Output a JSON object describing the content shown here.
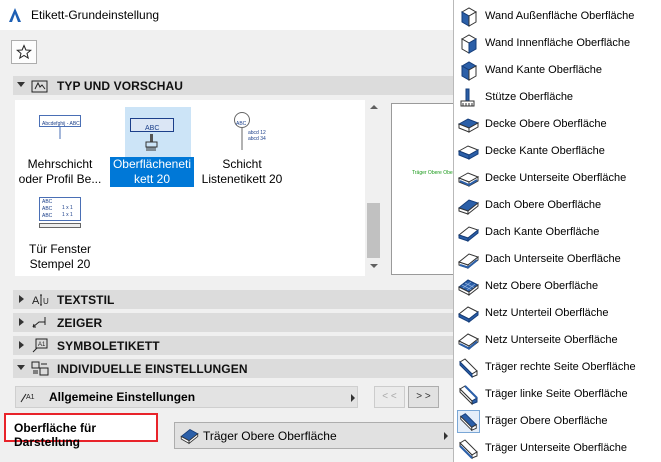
{
  "window": {
    "title": "Etikett-Grundeinstellung"
  },
  "favorites": {
    "icon": "star-icon"
  },
  "sections": {
    "typ": "TYP UND VORSCHAU",
    "textstil": "TEXTSTIL",
    "zeiger": "ZEIGER",
    "symbol": "SYMBOLETIKETT",
    "individuell": "INDIVIDUELLE EINSTELLUNGEN"
  },
  "gallery": {
    "items": [
      {
        "line1": "Mehrschicht",
        "line2": "oder Profil Be...",
        "thumb_text": "Abcdefghij - ABC"
      },
      {
        "line1": "Oberflächeneti",
        "line2": "kett 20",
        "thumb_text": "ABC"
      },
      {
        "line1": "Schicht",
        "line2": "Listenetikett 20",
        "thumb_text": "ABC",
        "thumb_sub1": "abcd 12",
        "thumb_sub2": "abcd 34"
      },
      {
        "line1": "Tür Fenster",
        "line2": "Stempel 20",
        "thumb_rows": [
          "ABC",
          "ABC",
          "ABC"
        ],
        "thumb_vals": [
          "1 x 1",
          "1 x 1"
        ]
      }
    ],
    "selected_index": 1
  },
  "preview": {
    "text": "Träger Obere Oberfläche"
  },
  "settings_combo": {
    "label": "Allgemeine Einstellungen"
  },
  "nav": {
    "prev": "< <",
    "next": "> >"
  },
  "surface_label": "Oberfläche für Darstellung",
  "surface_value": "Träger Obere Oberfläche",
  "menu": {
    "selected": "Träger Obere Oberfläche",
    "items": [
      "Wand Außenfläche Oberfläche",
      "Wand Innenfläche Oberfläche",
      "Wand Kante Oberfläche",
      "Stütze Oberfläche",
      "Decke Obere Oberfläche",
      "Decke Kante Oberfläche",
      "Decke Unterseite Oberfläche",
      "Dach Obere Oberfläche",
      "Dach Kante Oberfläche",
      "Dach Unterseite Oberfläche",
      "Netz Obere Oberfläche",
      "Netz Unterteil Oberfläche",
      "Netz Unterseite Oberfläche",
      "Träger rechte Seite Oberfläche",
      "Träger linke Seite Oberfläche",
      "Träger Obere Oberfläche",
      "Träger Unterseite Oberfläche"
    ]
  },
  "colors": {
    "accent": "#0078d7",
    "selection_bg": "#cce4f7",
    "highlight_border": "#e8232a",
    "icon_blue": "#2b5fa8"
  }
}
